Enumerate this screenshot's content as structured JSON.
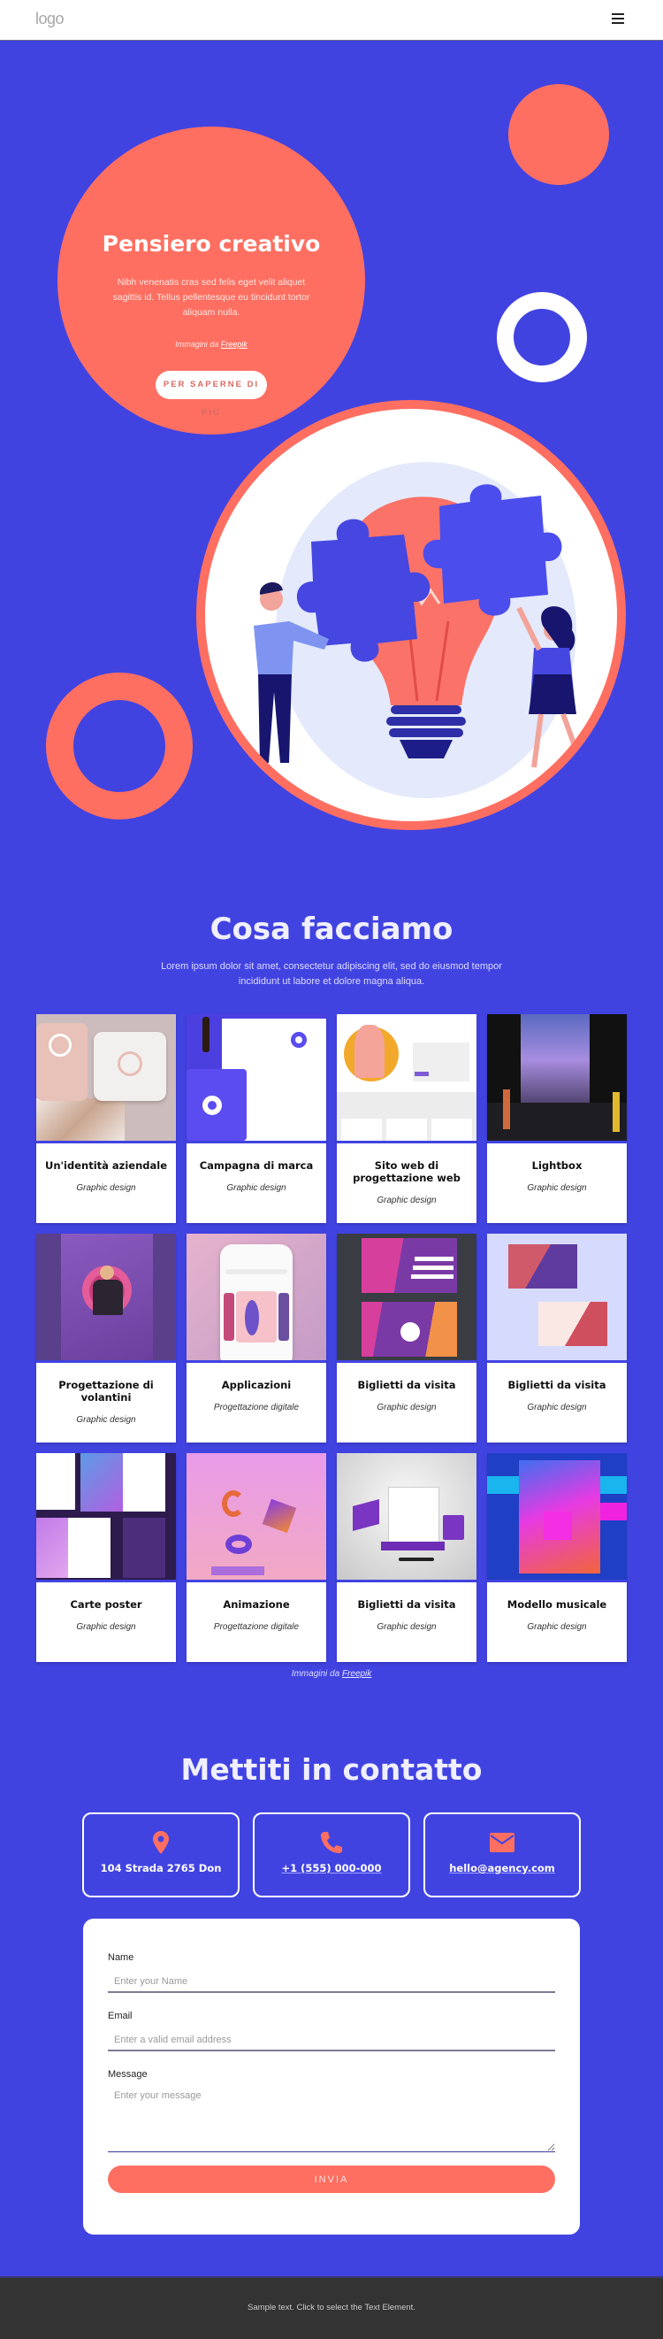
{
  "header": {
    "logo": "logo",
    "menu_icon": "hamburger-menu-icon"
  },
  "hero": {
    "title": "Pensiero creativo",
    "text": "Nibh venenatis cras sed felis eget velit aliquet sagittis id. Tellus pellentesque eu tincidunt tortor aliquam nulla.",
    "credit_prefix": "Immagini da ",
    "credit_link": "Freepik",
    "button": "PER SAPERNE DI PIÙ",
    "illustration": "lightbulb-puzzle-illustration"
  },
  "colors": {
    "background": "#4143e1",
    "accent": "#fe6f61",
    "white": "#ffffff",
    "footer": "#333333"
  },
  "services": {
    "title": "Cosa facciamo",
    "subtitle": "Lorem ipsum dolor sit amet, consectetur adipiscing elit, sed do eiusmod tempor incididunt ut labore et dolore magna aliqua.",
    "cards": [
      {
        "title": "Un'identità aziendale",
        "subtitle": "Graphic design",
        "image": "business-card-mockup"
      },
      {
        "title": "Campagna di marca",
        "subtitle": "Graphic design",
        "image": "branding-stationery-mockup"
      },
      {
        "title": "Sito web di progettazione web",
        "subtitle": "Graphic design",
        "image": "website-mockup"
      },
      {
        "title": "Lightbox",
        "subtitle": "Graphic design",
        "image": "night-party-poster"
      },
      {
        "title": "Progettazione di volantini",
        "subtitle": "Graphic design",
        "image": "flyer-mockup"
      },
      {
        "title": "Applicazioni",
        "subtitle": "Progettazione digitale",
        "image": "phone-app-mockup"
      },
      {
        "title": "Biglietti da visita",
        "subtitle": "Graphic design",
        "image": "business-cards-pink"
      },
      {
        "title": "Biglietti da visita",
        "subtitle": "Graphic design",
        "image": "business-cards-pastel"
      },
      {
        "title": "Carte poster",
        "subtitle": "Graphic design",
        "image": "poster-pages"
      },
      {
        "title": "Animazione",
        "subtitle": "Progettazione digitale",
        "image": "3d-shapes-poster"
      },
      {
        "title": "Biglietti da visita",
        "subtitle": "Graphic design",
        "image": "desk-calendar-mockup"
      },
      {
        "title": "Modello musicale",
        "subtitle": "Graphic design",
        "image": "karaoke-poster"
      }
    ],
    "credit_prefix": "Immagini da ",
    "credit_link": "Freepik"
  },
  "contact": {
    "title": "Mettiti in contatto",
    "address": "104 Strada 2765 Don",
    "phone": "+1 (555) 000-000",
    "email": "hello@agency.com",
    "form": {
      "name_label": "Name",
      "name_placeholder": "Enter your Name",
      "email_label": "Email",
      "email_placeholder": "Enter a valid email address",
      "message_label": "Message",
      "message_placeholder": "Enter your message",
      "submit": "INVIA"
    }
  },
  "footer": {
    "text": "Sample text. Click to select the Text Element."
  }
}
